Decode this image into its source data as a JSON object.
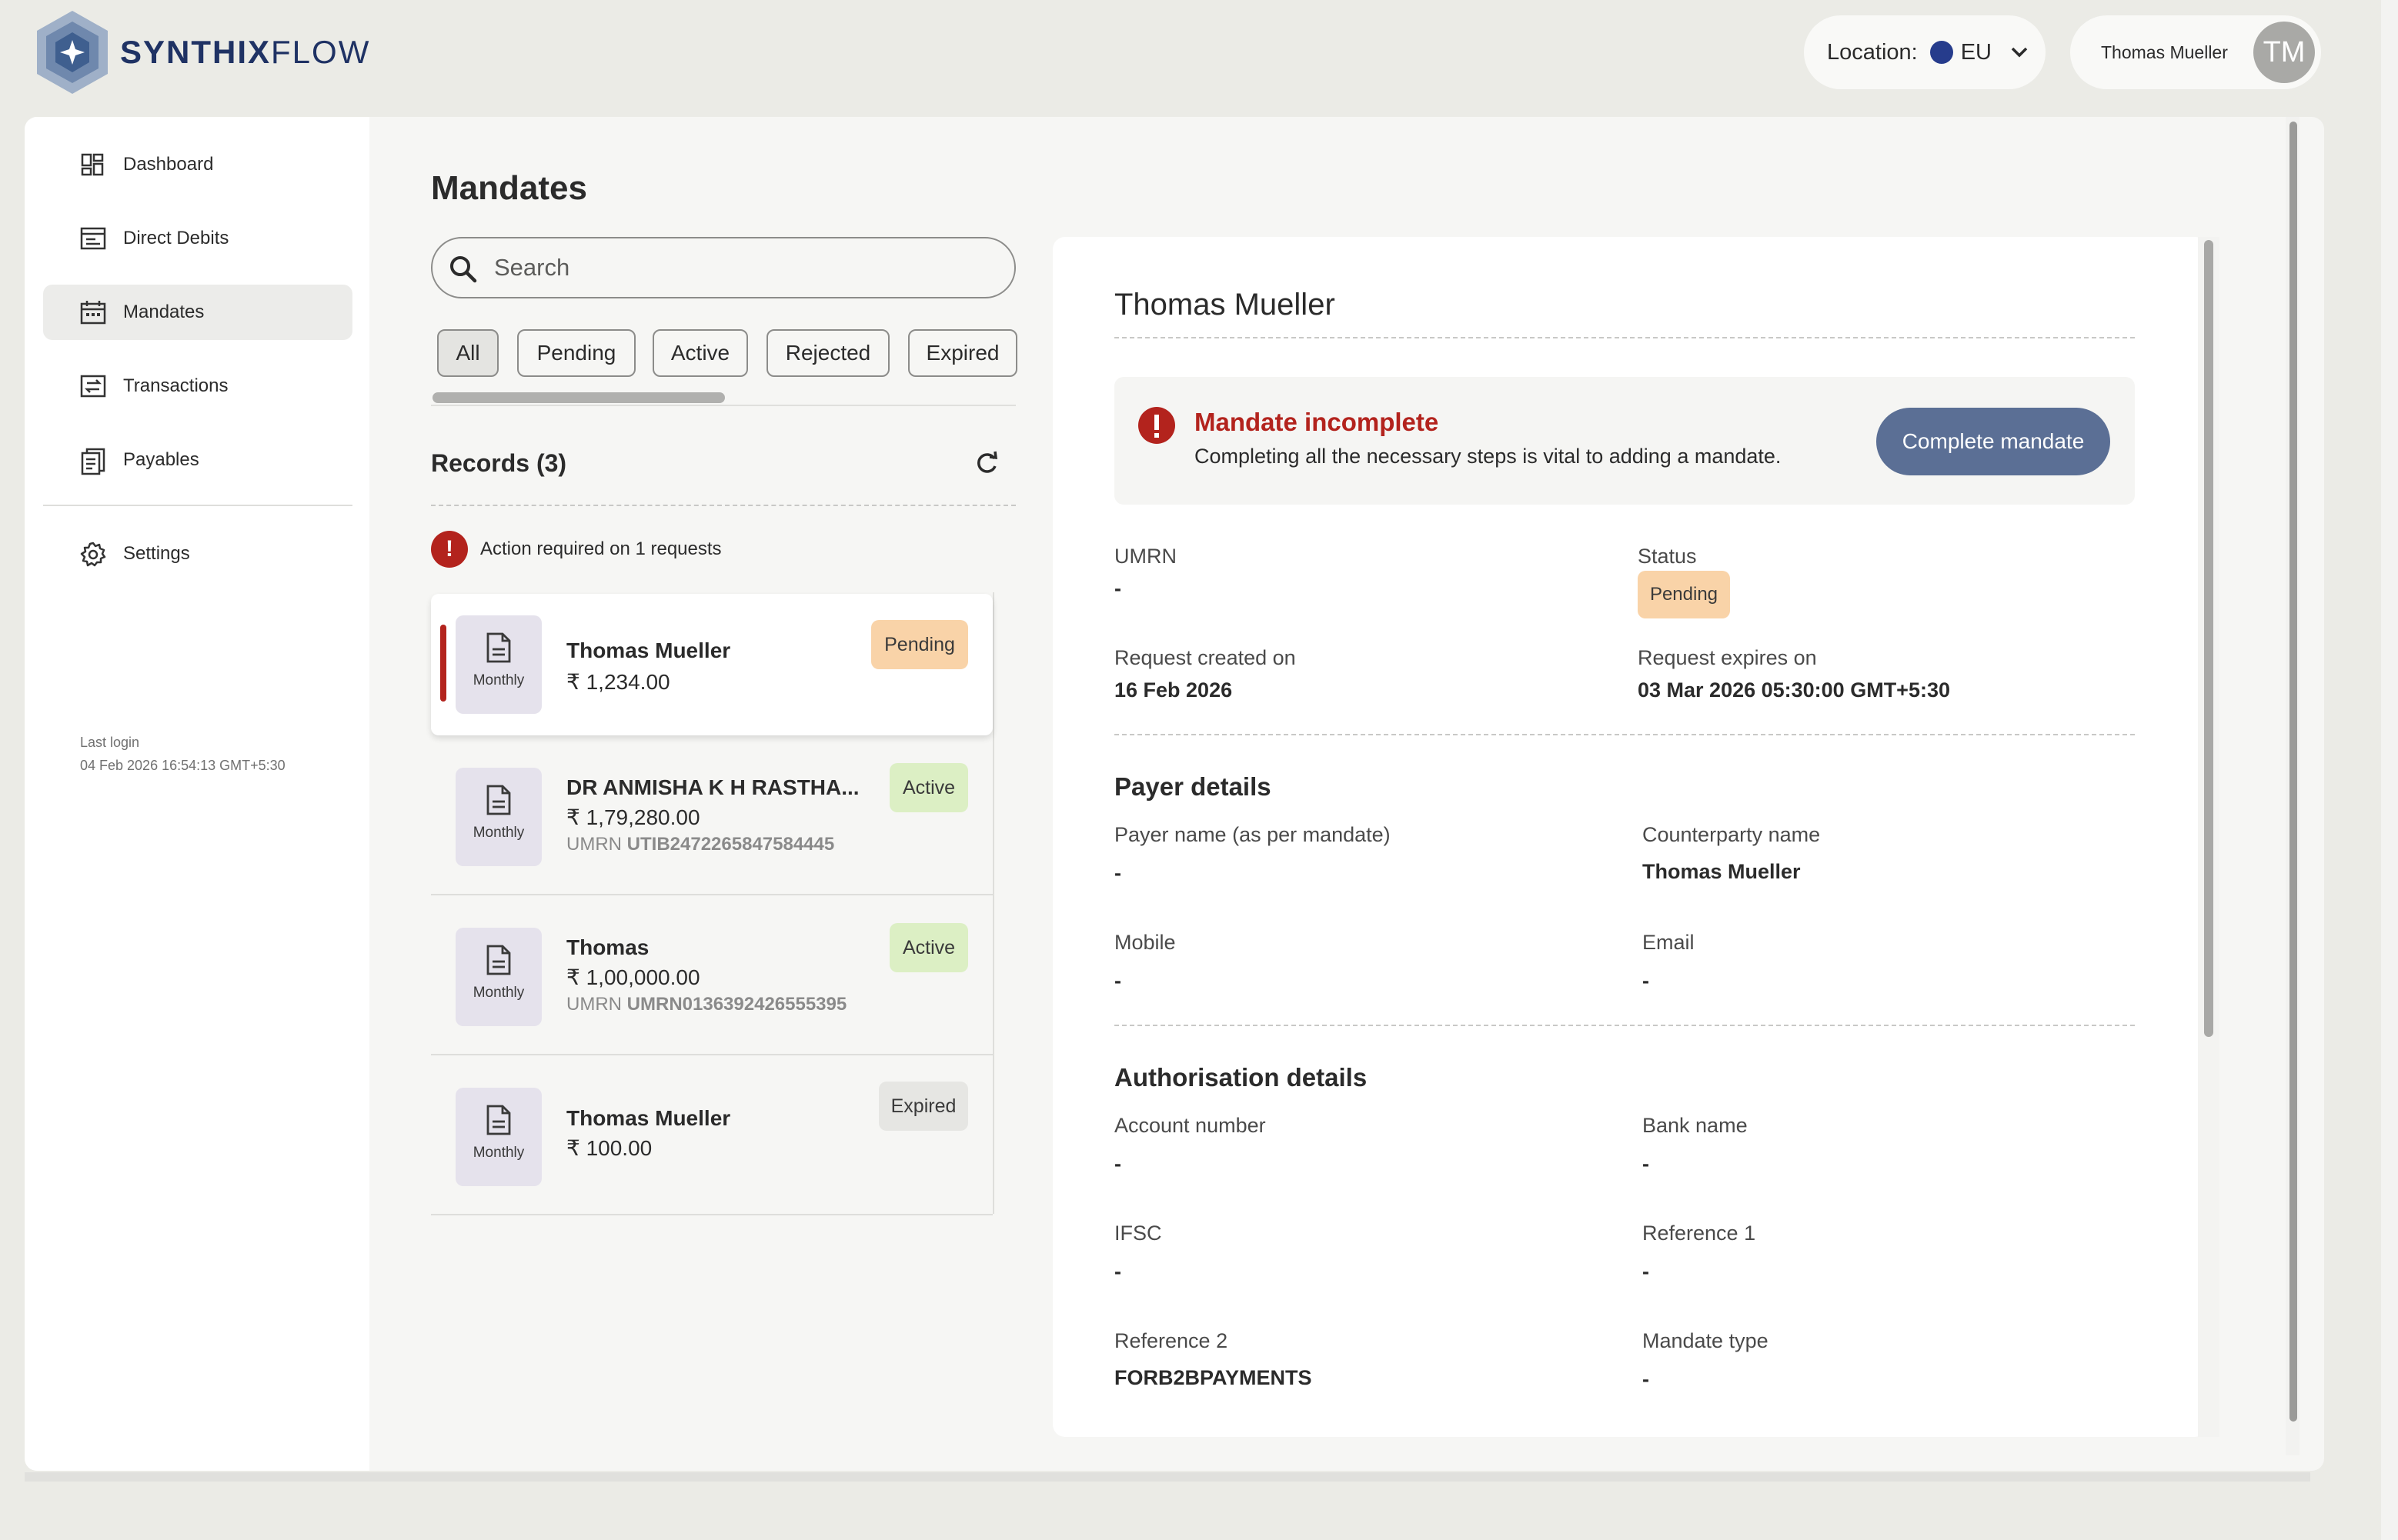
{
  "brand": {
    "name_bold": "SYNTHIX",
    "name_light": "FLOW"
  },
  "header": {
    "location_label": "Location:",
    "location_value": "EU",
    "user_name": "Thomas Mueller",
    "avatar_initials": "TM"
  },
  "sidebar": {
    "items": [
      {
        "label": "Dashboard",
        "icon": "dashboard-icon"
      },
      {
        "label": "Direct Debits",
        "icon": "direct-debits-icon"
      },
      {
        "label": "Mandates",
        "icon": "calendar-icon",
        "active": true
      },
      {
        "label": "Transactions",
        "icon": "transfer-icon"
      },
      {
        "label": "Payables",
        "icon": "payables-icon"
      }
    ],
    "settings_label": "Settings",
    "last_login_label": "Last login",
    "last_login_value": "04 Feb 2026 16:54:13 GMT+5:30"
  },
  "mandates": {
    "title": "Mandates",
    "search_placeholder": "Search",
    "filters": [
      "All",
      "Pending",
      "Active",
      "Rejected",
      "Expired"
    ],
    "selected_filter": "All",
    "records_label": "Records (3)",
    "action_required": "Action required on 1 requests",
    "list": [
      {
        "name": "Thomas Mueller",
        "amount": "₹ 1,234.00",
        "frequency": "Monthly",
        "status": "Pending",
        "umrn_label": "",
        "umrn": ""
      },
      {
        "name": "DR ANMISHA K H RASTHA...",
        "amount": "₹ 1,79,280.00",
        "frequency": "Monthly",
        "status": "Active",
        "umrn_label": "UMRN",
        "umrn": "UTIB2472265847584445"
      },
      {
        "name": "Thomas",
        "amount": "₹ 1,00,000.00",
        "frequency": "Monthly",
        "status": "Active",
        "umrn_label": "UMRN",
        "umrn": "UMRN0136392426555395"
      },
      {
        "name": "Thomas Mueller",
        "amount": "₹ 100.00",
        "frequency": "Monthly",
        "status": "Expired",
        "umrn_label": "",
        "umrn": ""
      }
    ]
  },
  "detail": {
    "name": "Thomas Mueller",
    "warning_title": "Mandate incomplete",
    "warning_text": "Completing all the necessary steps is vital to adding a mandate.",
    "complete_button": "Complete mandate",
    "umrn_label": "UMRN",
    "umrn_value": "-",
    "status_label": "Status",
    "status_value": "Pending",
    "created_label": "Request created on",
    "created_value": "16 Feb 2026",
    "expires_label": "Request expires on",
    "expires_value": "03 Mar 2026 05:30:00 GMT+5:30",
    "payer_section": "Payer details",
    "payer_name_label": "Payer name (as per mandate)",
    "payer_name_value": "-",
    "counterparty_label": "Counterparty name",
    "counterparty_value": "Thomas Mueller",
    "mobile_label": "Mobile",
    "mobile_value": "-",
    "email_label": "Email",
    "email_value": "-",
    "auth_section": "Authorisation details",
    "account_label": "Account number",
    "account_value": "-",
    "bank_label": "Bank name",
    "bank_value": "-",
    "ifsc_label": "IFSC",
    "ifsc_value": "-",
    "ref1_label": "Reference 1",
    "ref1_value": "-",
    "ref2_label": "Reference 2",
    "ref2_value": "FORB2BPAYMENTS",
    "mandate_type_label": "Mandate type",
    "mandate_type_value": "-"
  },
  "colors": {
    "brand": "#1f3264",
    "danger": "#b3231d",
    "primary_button": "#5b6f95",
    "pending": "#f9d3a8",
    "active": "#dcefc4",
    "expired": "#e6e6e3"
  }
}
